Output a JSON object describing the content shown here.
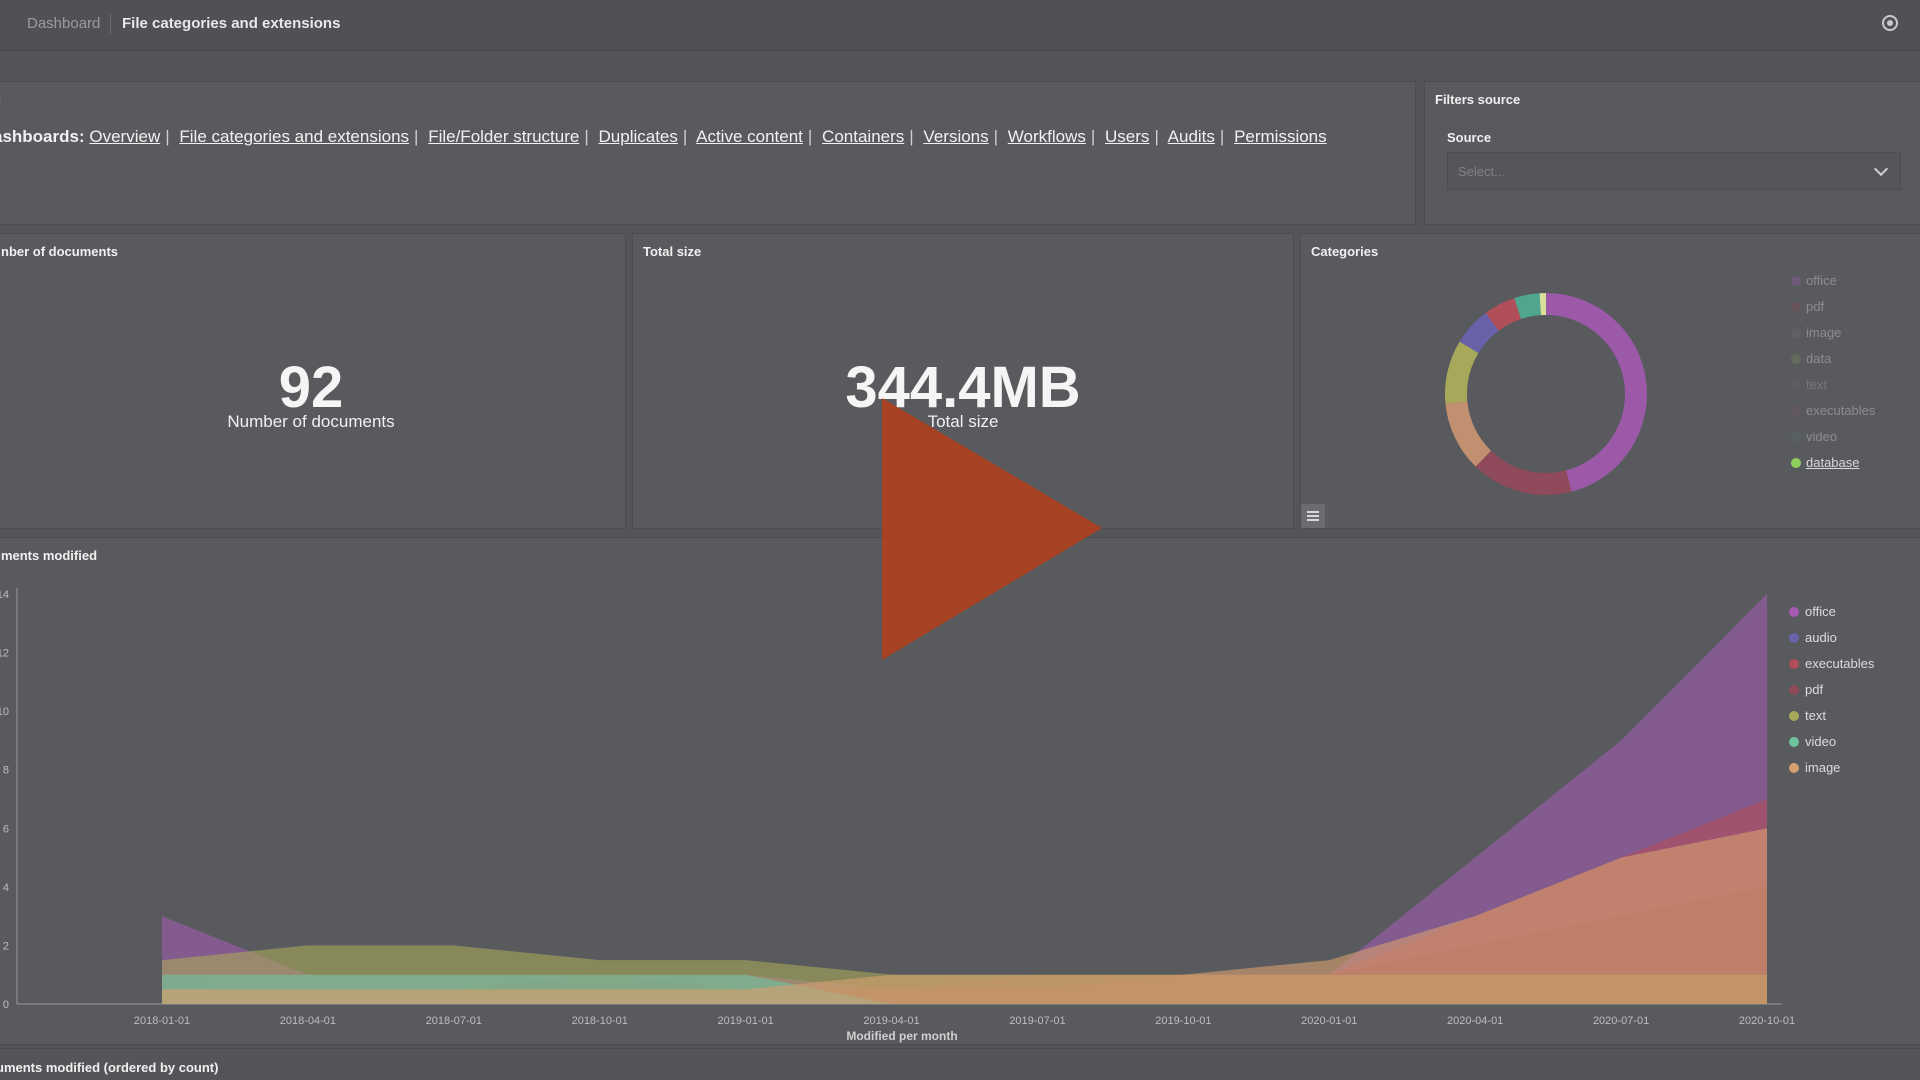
{
  "breadcrumb": {
    "root": "Dashboard",
    "current": "File categories and extensions"
  },
  "menu": {
    "title": "u",
    "lead": "ashboards:",
    "links": [
      "Overview",
      "File categories and extensions",
      "File/Folder structure",
      "Duplicates",
      "Active content",
      "Containers",
      "Versions",
      "Workflows",
      "Users",
      "Audits",
      "Permissions"
    ]
  },
  "filters": {
    "title": "Filters source",
    "source_label": "Source",
    "source_placeholder": "Select..."
  },
  "docs": {
    "title": "nber of documents",
    "value": "92",
    "label": "Number of documents"
  },
  "size": {
    "title": "Total size",
    "value": "344.4MB",
    "label": "Total size"
  },
  "categories": {
    "title": "Categories",
    "legend": [
      "office",
      "pdf",
      "image",
      "data",
      "text",
      "executables",
      "video",
      "database"
    ],
    "colors": [
      "#9b59a8",
      "#8e4a5a",
      "#6e6f73",
      "#7b8a5a",
      "#70716f",
      "#7a5563",
      "#5a6f70",
      "#8fcf5b"
    ]
  },
  "chart_data": [
    {
      "type": "pie",
      "title": "Categories",
      "labels": [
        "office",
        "pdf",
        "image",
        "data",
        "audio",
        "executables",
        "video",
        "database"
      ],
      "values": [
        45,
        16,
        11,
        10,
        6,
        5,
        4,
        1
      ],
      "colors": [
        "#9b59a8",
        "#8e4a5a",
        "#c09070",
        "#a8a85a",
        "#6a62a8",
        "#b04f5a",
        "#4fa58e",
        "#d8e09a"
      ]
    },
    {
      "type": "area",
      "title": "uments modified",
      "xlabel": "Modified per month",
      "ylabel": "",
      "ylim": [
        0,
        14
      ],
      "yticks": [
        0,
        2,
        4,
        6,
        8,
        10,
        12,
        14
      ],
      "x": [
        "2018-01-01",
        "2018-04-01",
        "2018-07-01",
        "2018-10-01",
        "2019-01-01",
        "2019-04-01",
        "2019-07-01",
        "2019-10-01",
        "2020-01-01",
        "2020-04-01",
        "2020-07-01",
        "2020-10-01"
      ],
      "series": [
        {
          "name": "office",
          "color": "#a25bb0",
          "values": [
            3,
            1,
            1,
            1,
            1,
            0.5,
            0.5,
            1,
            1,
            5,
            9,
            14
          ]
        },
        {
          "name": "audio",
          "color": "#6a62a8",
          "values": [
            1,
            0,
            0,
            0,
            0,
            0,
            0,
            0,
            0,
            0,
            0,
            0
          ]
        },
        {
          "name": "executables",
          "color": "#b04f5a",
          "values": [
            0.5,
            0.5,
            0.5,
            0.5,
            0.5,
            0.5,
            0.5,
            1,
            1,
            3,
            5,
            7
          ]
        },
        {
          "name": "pdf",
          "color": "#8e4a5a",
          "values": [
            0.5,
            0.5,
            0.5,
            1,
            0.5,
            0.5,
            1,
            1,
            1,
            2,
            3,
            4
          ]
        },
        {
          "name": "text",
          "color": "#a8a85a",
          "values": [
            1.5,
            2,
            2,
            1.5,
            1.5,
            1,
            1,
            1,
            1,
            1,
            1,
            1
          ]
        },
        {
          "name": "video",
          "color": "#6fc2a0",
          "values": [
            1,
            1,
            1,
            1,
            1,
            0,
            0,
            0,
            0,
            0,
            0,
            0
          ]
        },
        {
          "name": "image",
          "color": "#d8a070",
          "values": [
            0.5,
            0.5,
            0.5,
            0.5,
            0.5,
            1,
            1,
            1,
            1.5,
            3,
            5,
            6
          ]
        }
      ]
    }
  ],
  "bottom": {
    "title": "uments modified (ordered by count)"
  }
}
